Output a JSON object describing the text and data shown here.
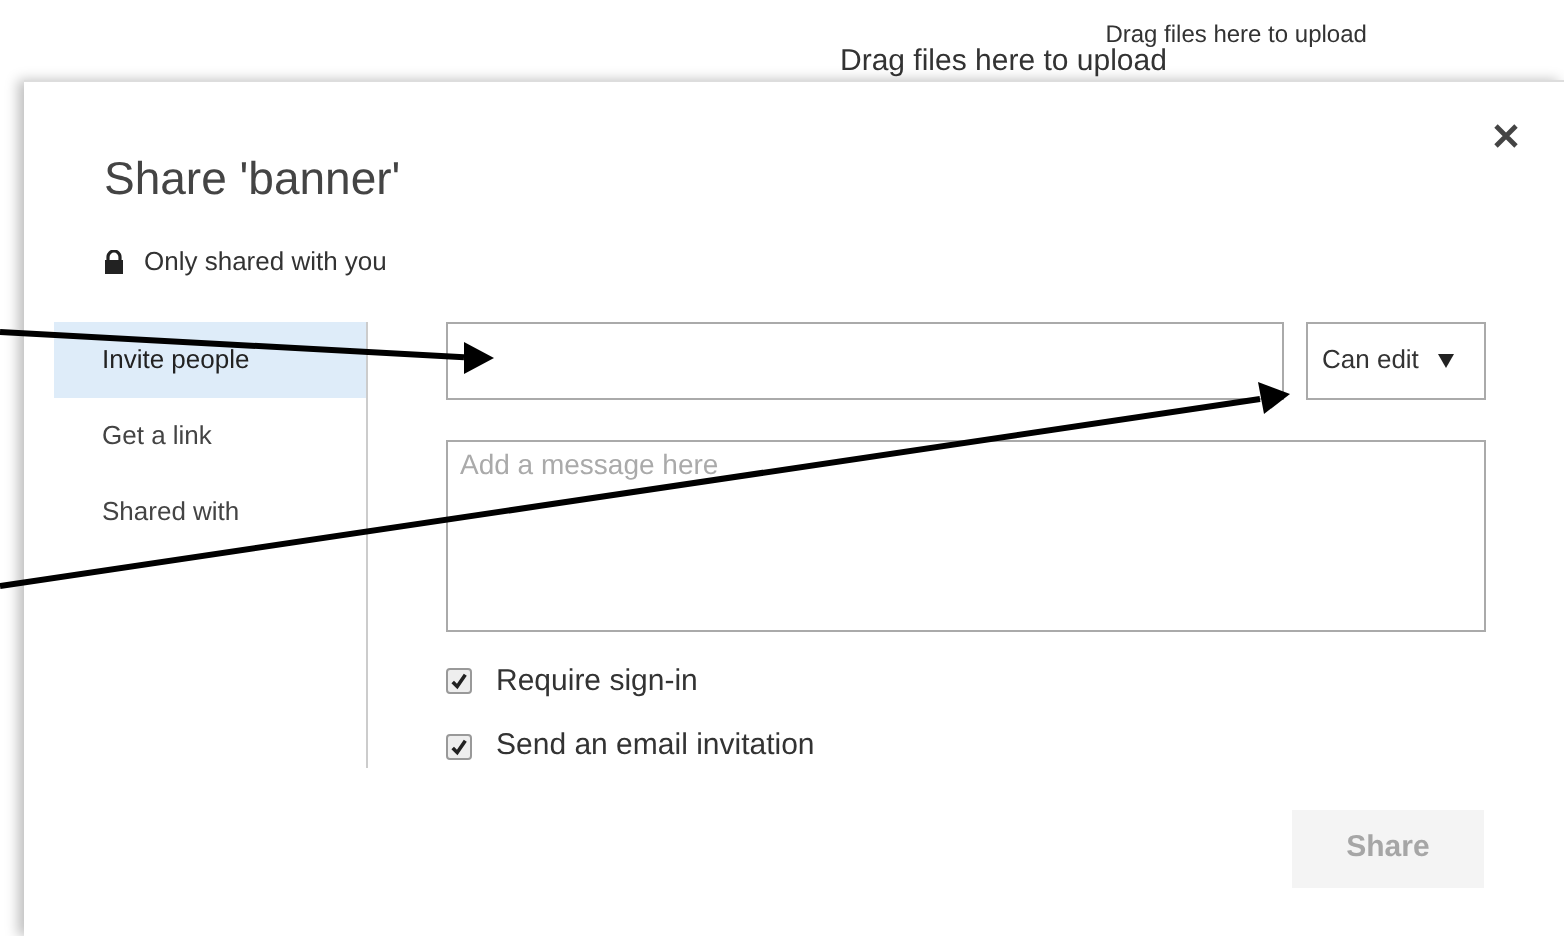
{
  "background_texts": [
    "Drag files here to upload",
    "Drag files here to upload"
  ],
  "dialog": {
    "title": "Share 'banner'",
    "sharing_status": "Only shared with you",
    "nav": [
      {
        "label": "Invite people",
        "selected": true
      },
      {
        "label": "Get a link",
        "selected": false
      },
      {
        "label": "Shared with",
        "selected": false
      }
    ],
    "permission": "Can edit",
    "message": {
      "placeholder": "Add a message here"
    },
    "options": [
      {
        "label": "Require sign-in",
        "checked": true
      },
      {
        "label": "Send an email invitation",
        "checked": true
      }
    ],
    "share_button": {
      "label": "Share",
      "disabled": true
    }
  }
}
